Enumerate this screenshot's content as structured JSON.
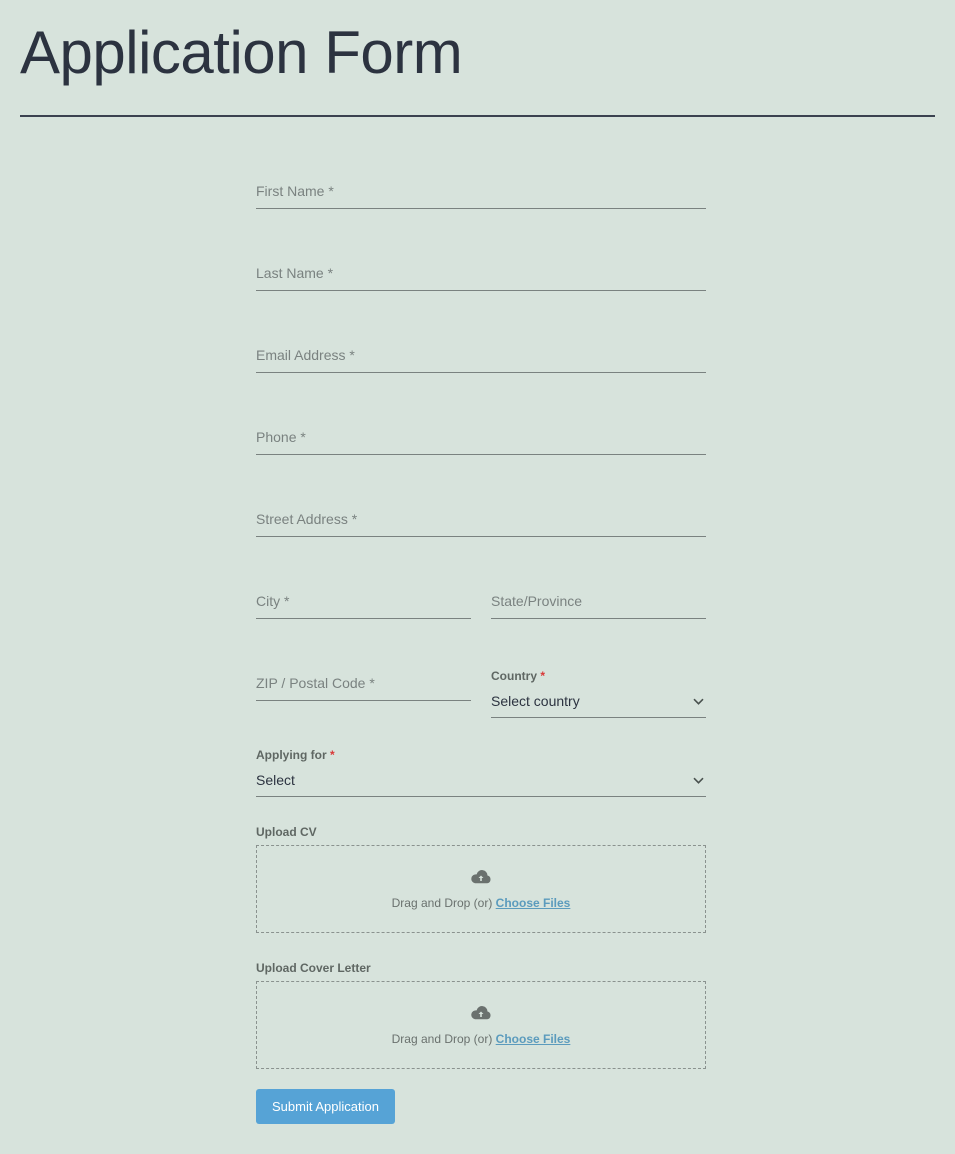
{
  "page": {
    "title": "Application Form"
  },
  "form": {
    "first_name": {
      "placeholder": "First Name *"
    },
    "last_name": {
      "placeholder": "Last Name *"
    },
    "email": {
      "placeholder": "Email Address *"
    },
    "phone": {
      "placeholder": "Phone *"
    },
    "street": {
      "placeholder": "Street Address *"
    },
    "city": {
      "placeholder": "City *"
    },
    "state": {
      "placeholder": "State/Province"
    },
    "zip": {
      "placeholder": "ZIP / Postal Code *"
    },
    "country": {
      "label": "Country",
      "required_mark": "*",
      "selected": "Select country"
    },
    "applying_for": {
      "label": "Applying for",
      "required_mark": "*",
      "selected": "Select"
    },
    "upload_cv": {
      "label": "Upload CV",
      "drag_text": "Drag and Drop (or) ",
      "choose_text": "Choose Files"
    },
    "upload_cover": {
      "label": "Upload Cover Letter",
      "drag_text": "Drag and Drop (or) ",
      "choose_text": "Choose Files"
    },
    "submit_label": "Submit Application"
  }
}
